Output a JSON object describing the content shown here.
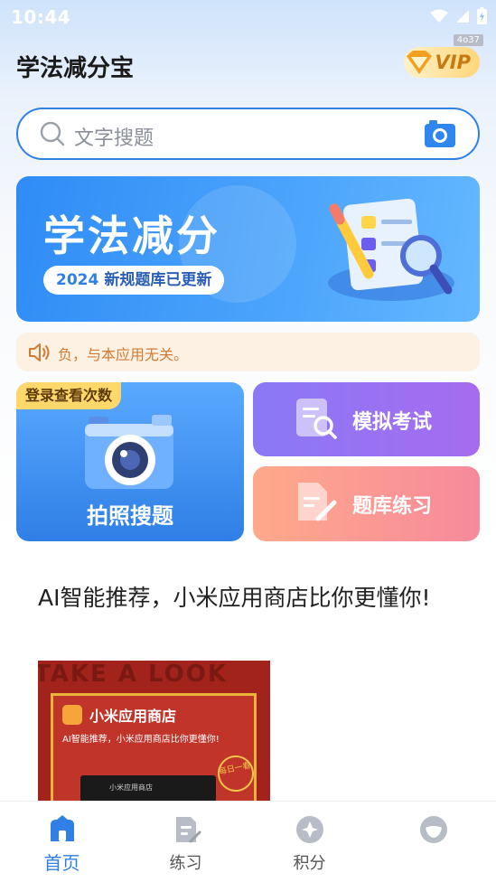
{
  "status_bar": {
    "time": "10:44",
    "badge": "4o37"
  },
  "header": {
    "title": "学法减分宝",
    "vip_label": "VIP"
  },
  "search": {
    "placeholder": "文字搜题"
  },
  "banner": {
    "title": "学法减分",
    "year": "2024",
    "subtitle": "新规题库已更新"
  },
  "notice": {
    "text": "负，与本应用无关。"
  },
  "cards": {
    "photo": {
      "tag": "登录查看次数",
      "label": "拍照搜题"
    },
    "mock_exam": {
      "label": "模拟考试"
    },
    "question_bank": {
      "label": "题库练习"
    }
  },
  "ad": {
    "text": "AI智能推荐，小米应用商店比你更懂你!",
    "image_bg_text": "TAKE A LOOK",
    "store_title": "小米应用商店",
    "store_sub": "AI智能推荐，小米应用商店比你更懂你!",
    "seal": "每日一看",
    "phone_label": "小米应用商店"
  },
  "bottom_nav": [
    {
      "label": "首页",
      "active": true
    },
    {
      "label": "练习",
      "active": false
    },
    {
      "label": "积分",
      "active": false
    },
    {
      "label": "",
      "active": false
    }
  ],
  "colors": {
    "accent": "#2f7fe6",
    "vip": "#c57b10",
    "notice": "#d27a32"
  }
}
